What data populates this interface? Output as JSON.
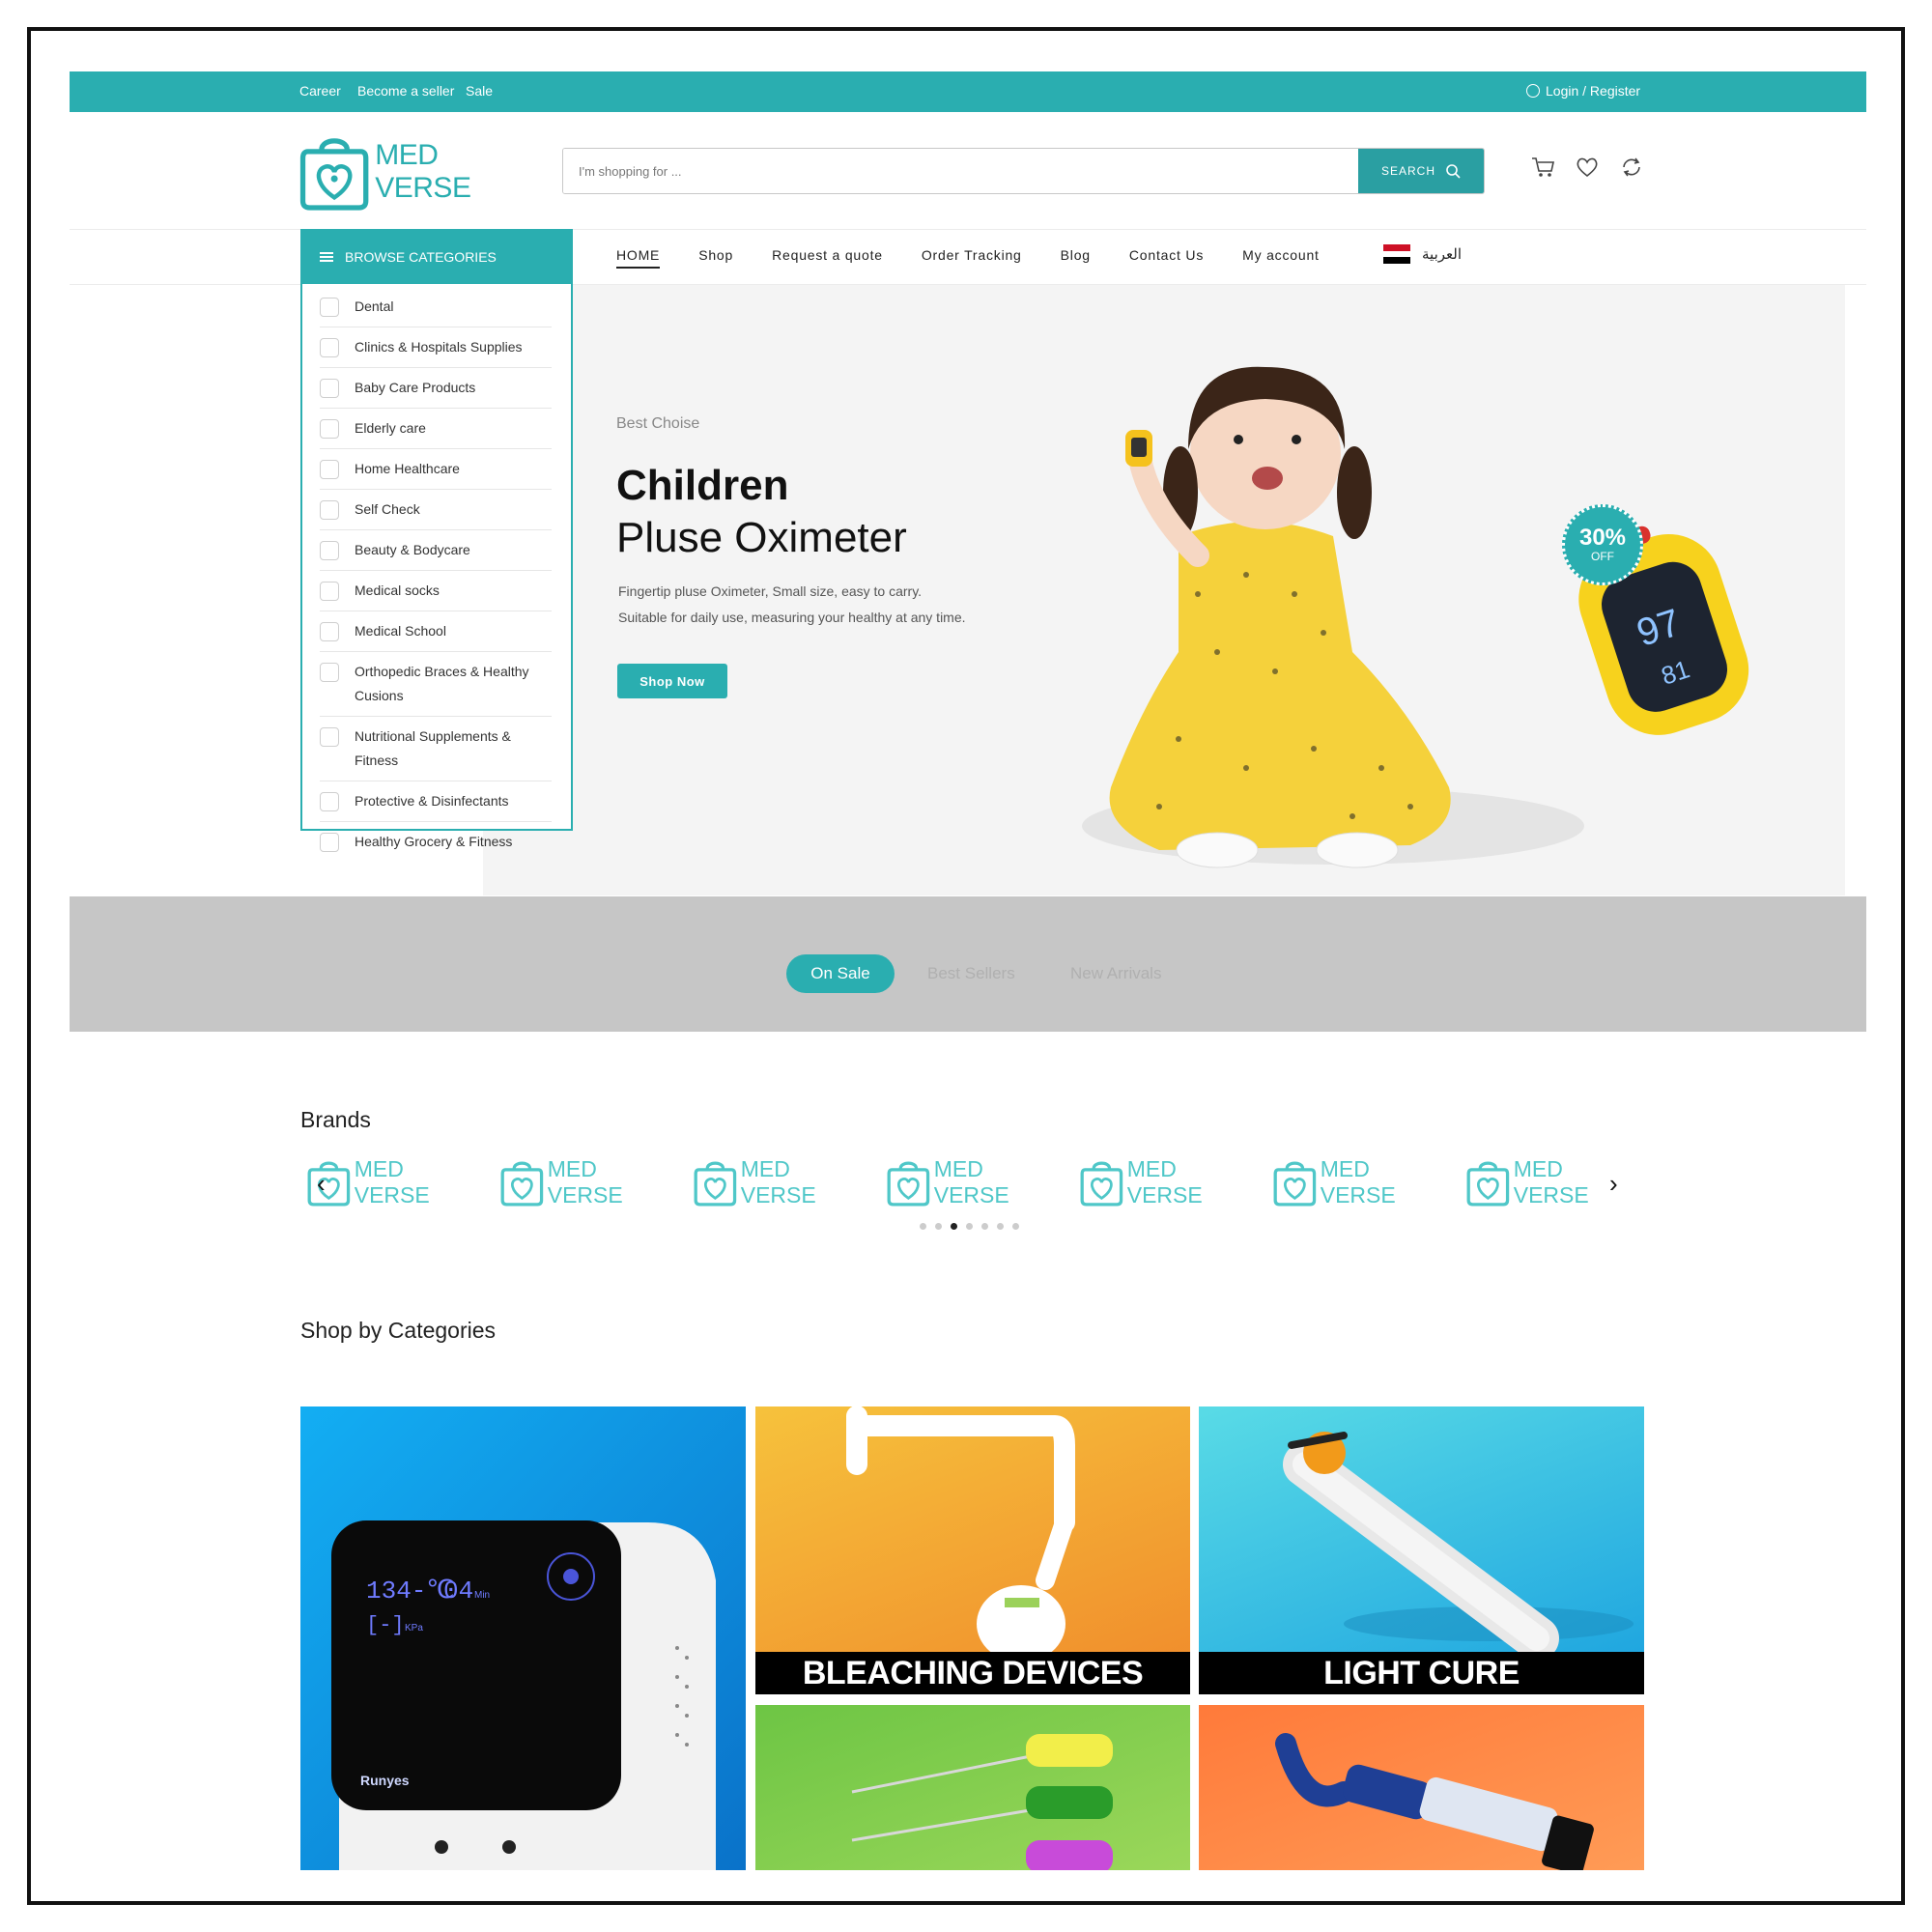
{
  "topbar": {
    "links": [
      "Career",
      "Become a seller",
      "Sale"
    ],
    "login_label": "Login / Register"
  },
  "header": {
    "logo_text": "MED VERSE",
    "search_placeholder": "I'm shopping for ...",
    "search_button": "SEARCH",
    "icons": [
      "cart-icon",
      "heart-icon",
      "refresh-icon"
    ]
  },
  "browse": {
    "title": "BROWSE CATEGORIES",
    "items": [
      "Dental",
      "Clinics & Hospitals Supplies",
      "Baby Care Products",
      "Elderly care",
      "Home Healthcare",
      "Self Check",
      "Beauty & Bodycare",
      "Medical socks",
      "Medical School",
      "Orthopedic Braces & Healthy Cusions",
      "Nutritional Supplements & Fitness",
      "Protective & Disinfectants",
      "Healthy Grocery & Fitness"
    ]
  },
  "nav": {
    "items": [
      "HOME",
      "Shop",
      "Request a quote",
      "Order Tracking",
      "Blog",
      "Contact Us",
      "My account"
    ],
    "language": "العربية"
  },
  "hero": {
    "subtitle": "Best Choise",
    "title_bold": "Children",
    "title_light": "Pluse Oximeter",
    "desc_line1": "Fingertip pluse Oximeter, Small size, easy to carry.",
    "desc_line2": "Suitable for daily use, measuring your healthy at any time.",
    "cta": "Shop Now",
    "badge_percent": "30%",
    "badge_off": "OFF"
  },
  "product_tabs": {
    "active": "On Sale",
    "others": [
      "Best Sellers",
      "New Arrivals"
    ]
  },
  "brands": {
    "title": "Brands",
    "logo_text": "MED VERSE",
    "prev": "‹",
    "next": "›",
    "active_dot": 3
  },
  "shop_by_categories": {
    "title": "Shop by Categories",
    "tiles": [
      "BLEACHING DEVICES",
      "LIGHT CURE"
    ],
    "device_display": {
      "temp": "134-℃",
      "time": "04",
      "time_unit": "Min",
      "pressure": "[-]",
      "pressure_unit": "KPa",
      "brand": "Runyes"
    },
    "oximeter_display": {
      "spo2": "97",
      "pr": "81"
    }
  },
  "colors": {
    "accent": "#2aaeb0",
    "tabs_band": "#c6c6c6"
  }
}
